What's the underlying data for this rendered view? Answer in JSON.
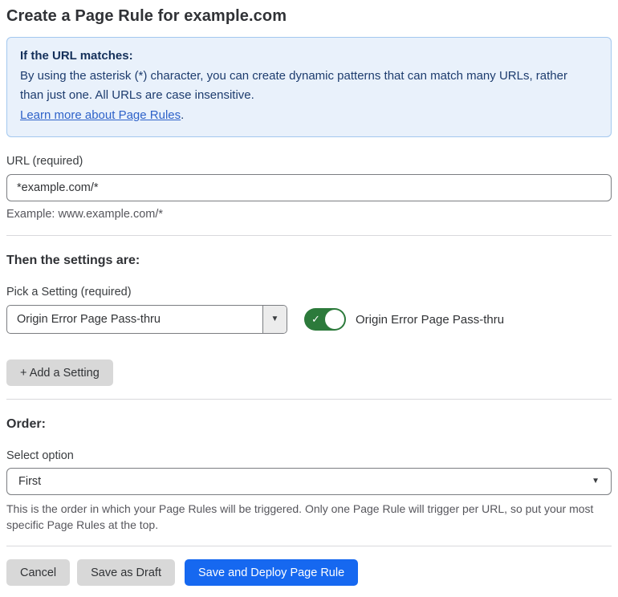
{
  "page": {
    "title": "Create a Page Rule for example.com"
  },
  "info_box": {
    "heading": "If the URL matches:",
    "body": "By using the asterisk (*) character, you can create dynamic patterns that can match many URLs, rather than just one. All URLs are case insensitive.",
    "link_label": "Learn more about Page Rules",
    "link_suffix": "."
  },
  "url_field": {
    "label": "URL (required)",
    "value": "*example.com/*",
    "helper": "Example: www.example.com/*"
  },
  "settings_section": {
    "heading": "Then the settings are:",
    "picker_label": "Pick a Setting (required)",
    "selected_setting": "Origin Error Page Pass-thru",
    "toggle_label": "Origin Error Page Pass-thru",
    "toggle_enabled": true,
    "add_setting_label": "+ Add a Setting"
  },
  "order_section": {
    "heading": "Order:",
    "select_label": "Select option",
    "selected_option": "First",
    "helper": "This is the order in which your Page Rules will be triggered. Only one Page Rule will trigger per URL, so put your most specific Page Rules at the top."
  },
  "footer": {
    "cancel_label": "Cancel",
    "save_draft_label": "Save as Draft",
    "save_deploy_label": "Save and Deploy Page Rule"
  },
  "icons": {
    "chevron_down": "▼",
    "check": "✓"
  },
  "colors": {
    "info_box_bg": "#e9f1fb",
    "info_box_border": "#a3c8ef",
    "info_text": "#1d3c6e",
    "link_blue": "#2e62c9",
    "toggle_green": "#2c7a3b",
    "primary_button_blue": "#1668f0",
    "secondary_button_gray": "#d8d8d8",
    "border_gray": "#7b7d81",
    "divider_gray": "#d9d9dc"
  }
}
